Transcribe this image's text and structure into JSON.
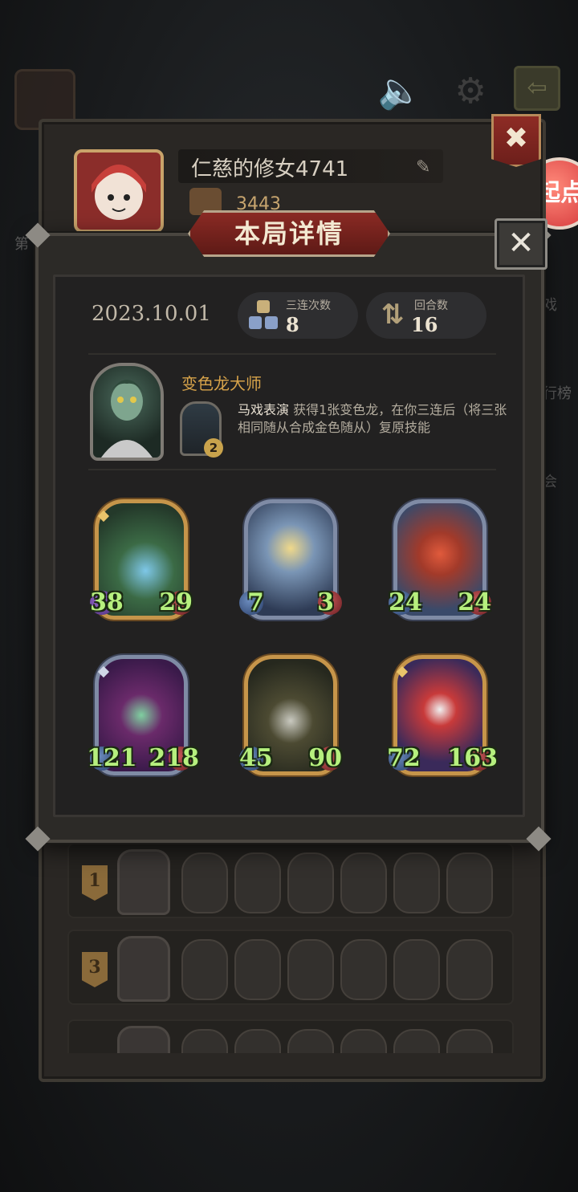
{
  "background": {
    "side_label_1": "第",
    "side_label_2": "戏",
    "side_label_3": "行榜",
    "side_label_4": "会",
    "qidian_label": "起点"
  },
  "profile": {
    "name": "仁慈的修女4741",
    "score": "3443"
  },
  "modal": {
    "title": "本局详情",
    "date": "2023.10.01",
    "triple_label": "三连次数",
    "triple_value": "8",
    "rounds_label": "回合数",
    "rounds_value": "16"
  },
  "hero": {
    "name": "变色龙大师",
    "skill_name": "马戏表演",
    "skill_desc": " 获得1张变色龙，在你三连后（将三张相同随从合成金色随从）复原技能",
    "skill_cost": "2"
  },
  "minions": [
    {
      "atk": "38",
      "hp": "29",
      "frame": "gold"
    },
    {
      "atk": "7",
      "hp": "3",
      "frame": "silver"
    },
    {
      "atk": "24",
      "hp": "24",
      "frame": "silver"
    },
    {
      "atk": "121",
      "hp": "218",
      "frame": "silver"
    },
    {
      "atk": "45",
      "hp": "90",
      "frame": "gold"
    },
    {
      "atk": "72",
      "hp": "163",
      "frame": "gold"
    }
  ],
  "history": [
    {
      "rank": "1"
    },
    {
      "rank": "3"
    }
  ],
  "colors": {
    "accent_red": "#8a2a24",
    "stat_green": "#b6f07e",
    "hero_gold": "#d7a34a"
  }
}
